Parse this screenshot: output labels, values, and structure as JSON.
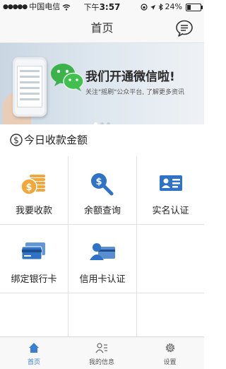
{
  "status_bar": {
    "carrier": "中国电信",
    "time_prefix": "下午",
    "time": "3:57",
    "battery": "24%"
  },
  "nav": {
    "title": "首页",
    "message_icon": "chat-bubble-icon"
  },
  "banner": {
    "title": "我们开通微信啦!",
    "subtitle": "关注\"摇刷\"公众平台, 了解更多资讯",
    "pages": 3,
    "active_page": 1
  },
  "income": {
    "label": "今日收款金额",
    "icon": "dollar-circle-icon"
  },
  "grid": {
    "items": [
      {
        "label": "我要收款",
        "icon": "coins-icon"
      },
      {
        "label": "余额查询",
        "icon": "magnifier-dollar-icon"
      },
      {
        "label": "实名认证",
        "icon": "id-card-icon"
      },
      {
        "label": "绑定银行卡",
        "icon": "bank-card-icon"
      },
      {
        "label": "信用卡认证",
        "icon": "credit-card-user-icon"
      }
    ]
  },
  "tab_bar": {
    "tabs": [
      {
        "label": "首页",
        "icon": "home-icon",
        "active": true
      },
      {
        "label": "我的信息",
        "icon": "user-list-icon",
        "active": false
      },
      {
        "label": "设置",
        "icon": "gear-icon",
        "active": false
      }
    ]
  },
  "colors": {
    "accent": "#3a7fd5",
    "coin": "#f0a83c",
    "icon_blue": "#2f73c6"
  }
}
